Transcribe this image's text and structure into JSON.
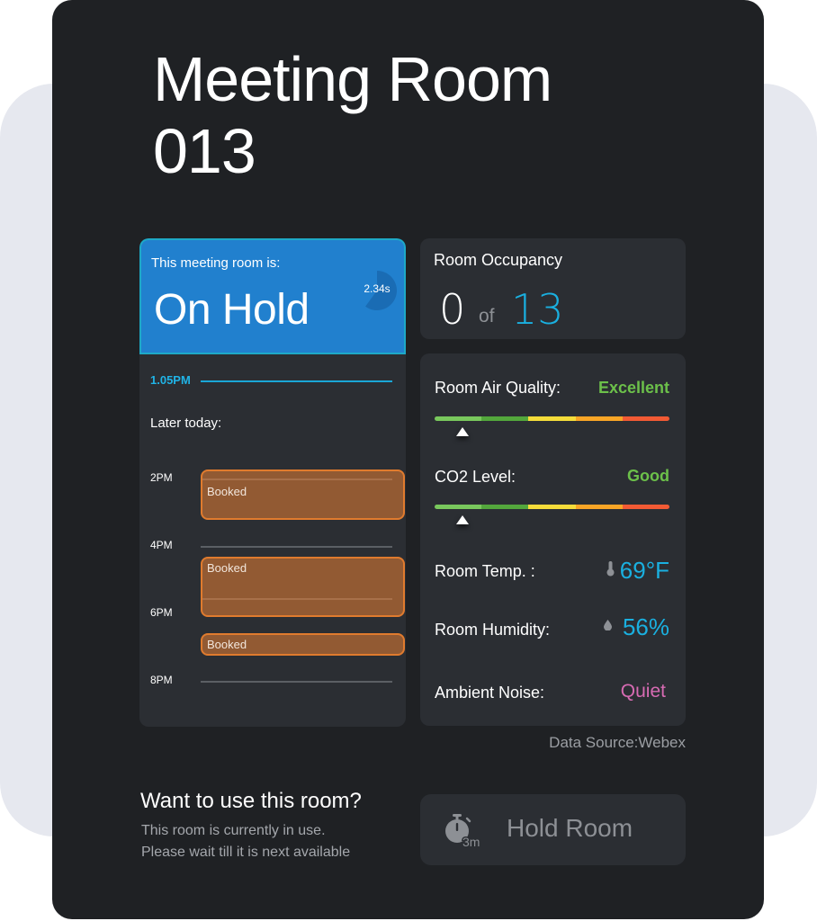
{
  "room": {
    "title_line1": "Meeting Room",
    "title_line2": "013"
  },
  "status": {
    "label": "This meeting room is:",
    "value": "On Hold",
    "timer_label": "2.34s",
    "timer_fraction": 0.6,
    "colors": {
      "header": "#2180ce",
      "header_border": "#1ea9c7",
      "timer_fill": "#1a6cb4"
    }
  },
  "schedule": {
    "current_time": "1.05PM",
    "later_label": "Later today:",
    "hours": [
      "2PM",
      "4PM",
      "6PM",
      "8PM"
    ],
    "bookings": [
      {
        "label": "Booked"
      },
      {
        "label": "Booked"
      },
      {
        "label": "Booked"
      }
    ],
    "colors": {
      "booking_fill": "#925a33",
      "booking_border": "#e07b2e",
      "now": "#20b3e6"
    }
  },
  "occupancy": {
    "title": "Room Occupancy",
    "current": "0",
    "of_label": "of",
    "capacity": "13"
  },
  "environment": {
    "air_quality": {
      "label": "Room Air Quality:",
      "value": "Excellent",
      "level_fraction": 0.12
    },
    "co2": {
      "label": "CO2 Level:",
      "value": "Good",
      "level_fraction": 0.12
    },
    "gauge_colors": [
      "#79c85d",
      "#53a73c",
      "#f5dc3a",
      "#f8a526",
      "#f25a34"
    ],
    "temperature": {
      "label": "Room Temp. :",
      "value": "69°F",
      "icon": "thermometer-icon"
    },
    "humidity": {
      "label": "Room Humidity:",
      "value": "56%",
      "icon": "droplet-icon"
    },
    "noise": {
      "label": "Ambient Noise:",
      "value": "Quiet"
    },
    "colors": {
      "good": "#6cc04a",
      "metric": "#1ab0e0",
      "noise": "#d76bb3"
    }
  },
  "data_source": "Data Source:Webex",
  "reserve": {
    "title": "Want to use this room?",
    "line1": "This room is currently in use.",
    "line2": "Please wait till it is next available",
    "button_label": "Hold Room",
    "button_icon": "stopwatch-icon",
    "button_icon_badge": "3m"
  }
}
